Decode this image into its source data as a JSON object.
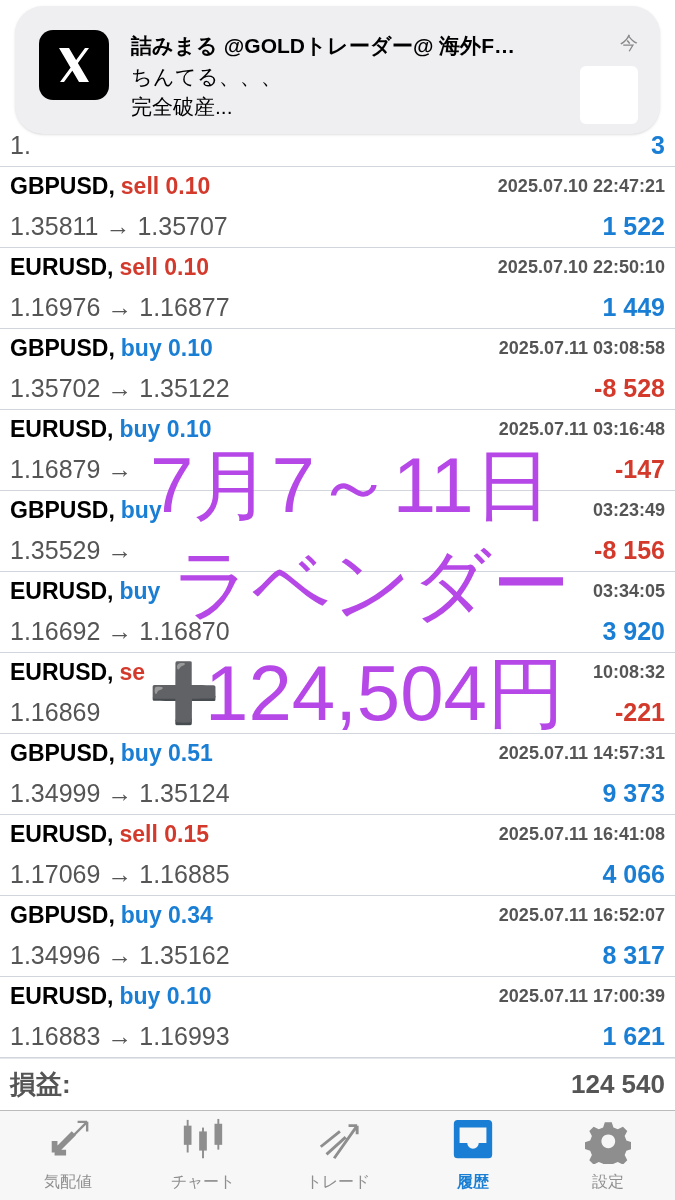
{
  "partial_row": {
    "prices": "1.",
    "profit": "3"
  },
  "deals": [
    {
      "symbol": "GBPUSD,",
      "order": {
        "text": "sell 0.10",
        "color": "#d33a2c"
      },
      "time": "2025.07.10 22:47:21",
      "prices": "1.35811 → 1.35707",
      "profit": {
        "text": "1 522",
        "color": "#1a7fd4"
      }
    },
    {
      "symbol": "EURUSD,",
      "order": {
        "text": "sell 0.10",
        "color": "#d33a2c"
      },
      "time": "2025.07.10 22:50:10",
      "prices": "1.16976 → 1.16877",
      "profit": {
        "text": "1 449",
        "color": "#1a7fd4"
      }
    },
    {
      "symbol": "GBPUSD,",
      "order": {
        "text": "buy 0.10",
        "color": "#1a7fd4"
      },
      "time": "2025.07.11 03:08:58",
      "prices": "1.35702 → 1.35122",
      "profit": {
        "text": "-8 528",
        "color": "#d33a2c"
      }
    },
    {
      "symbol": "EURUSD,",
      "order": {
        "text": "buy 0.10",
        "color": "#1a7fd4"
      },
      "time": "2025.07.11 03:16:48",
      "prices": "1.16879 →",
      "profit": {
        "text": "-147",
        "color": "#d33a2c"
      }
    },
    {
      "symbol": "GBPUSD,",
      "order": {
        "text": "buy",
        "color": "#1a7fd4"
      },
      "time": "03:23:49",
      "prices": "1.35529 →",
      "profit": {
        "text": "-8 156",
        "color": "#d33a2c"
      }
    },
    {
      "symbol": "EURUSD,",
      "order": {
        "text": "buy",
        "color": "#1a7fd4"
      },
      "time": "03:34:05",
      "prices": "1.16692 → 1.16870",
      "profit": {
        "text": "3 920",
        "color": "#1a7fd4"
      }
    },
    {
      "symbol": "EURUSD,",
      "order": {
        "text": "se",
        "color": "#d33a2c"
      },
      "time": "10:08:32",
      "prices": "1.16869",
      "profit": {
        "text": "-221",
        "color": "#d33a2c"
      }
    },
    {
      "symbol": "GBPUSD,",
      "order": {
        "text": "buy 0.51",
        "color": "#1a7fd4"
      },
      "time": "2025.07.11 14:57:31",
      "prices": "1.34999 → 1.35124",
      "profit": {
        "text": "9 373",
        "color": "#1a7fd4"
      }
    },
    {
      "symbol": "EURUSD,",
      "order": {
        "text": "sell 0.15",
        "color": "#d33a2c"
      },
      "time": "2025.07.11 16:41:08",
      "prices": "1.17069 → 1.16885",
      "profit": {
        "text": "4 066",
        "color": "#1a7fd4"
      }
    },
    {
      "symbol": "GBPUSD,",
      "order": {
        "text": "buy 0.34",
        "color": "#1a7fd4"
      },
      "time": "2025.07.11 16:52:07",
      "prices": "1.34996 → 1.35162",
      "profit": {
        "text": "8 317",
        "color": "#1a7fd4"
      }
    },
    {
      "symbol": "EURUSD,",
      "order": {
        "text": "buy 0.10",
        "color": "#1a7fd4"
      },
      "time": "2025.07.11 17:00:39",
      "prices": "1.16883 → 1.16993",
      "profit": {
        "text": "1 621",
        "color": "#1a7fd4"
      }
    }
  ],
  "summary": {
    "label": "損益:",
    "value": "124 540"
  },
  "tabs": [
    {
      "label": "気配値",
      "selected": false
    },
    {
      "label": "チャート",
      "selected": false
    },
    {
      "label": "トレード",
      "selected": false
    },
    {
      "label": "履歴",
      "selected": true
    },
    {
      "label": "設定",
      "selected": false
    }
  ],
  "notification": {
    "title": "詰みまる @GOLDトレーダー@ 海外F…",
    "time": "今",
    "lines": [
      "ちんてる、、、",
      "完全破産..."
    ]
  },
  "annotation": {
    "lines": [
      "7月7～11日",
      "ラベンダー",
      "124,504円"
    ],
    "sign": "➕"
  }
}
